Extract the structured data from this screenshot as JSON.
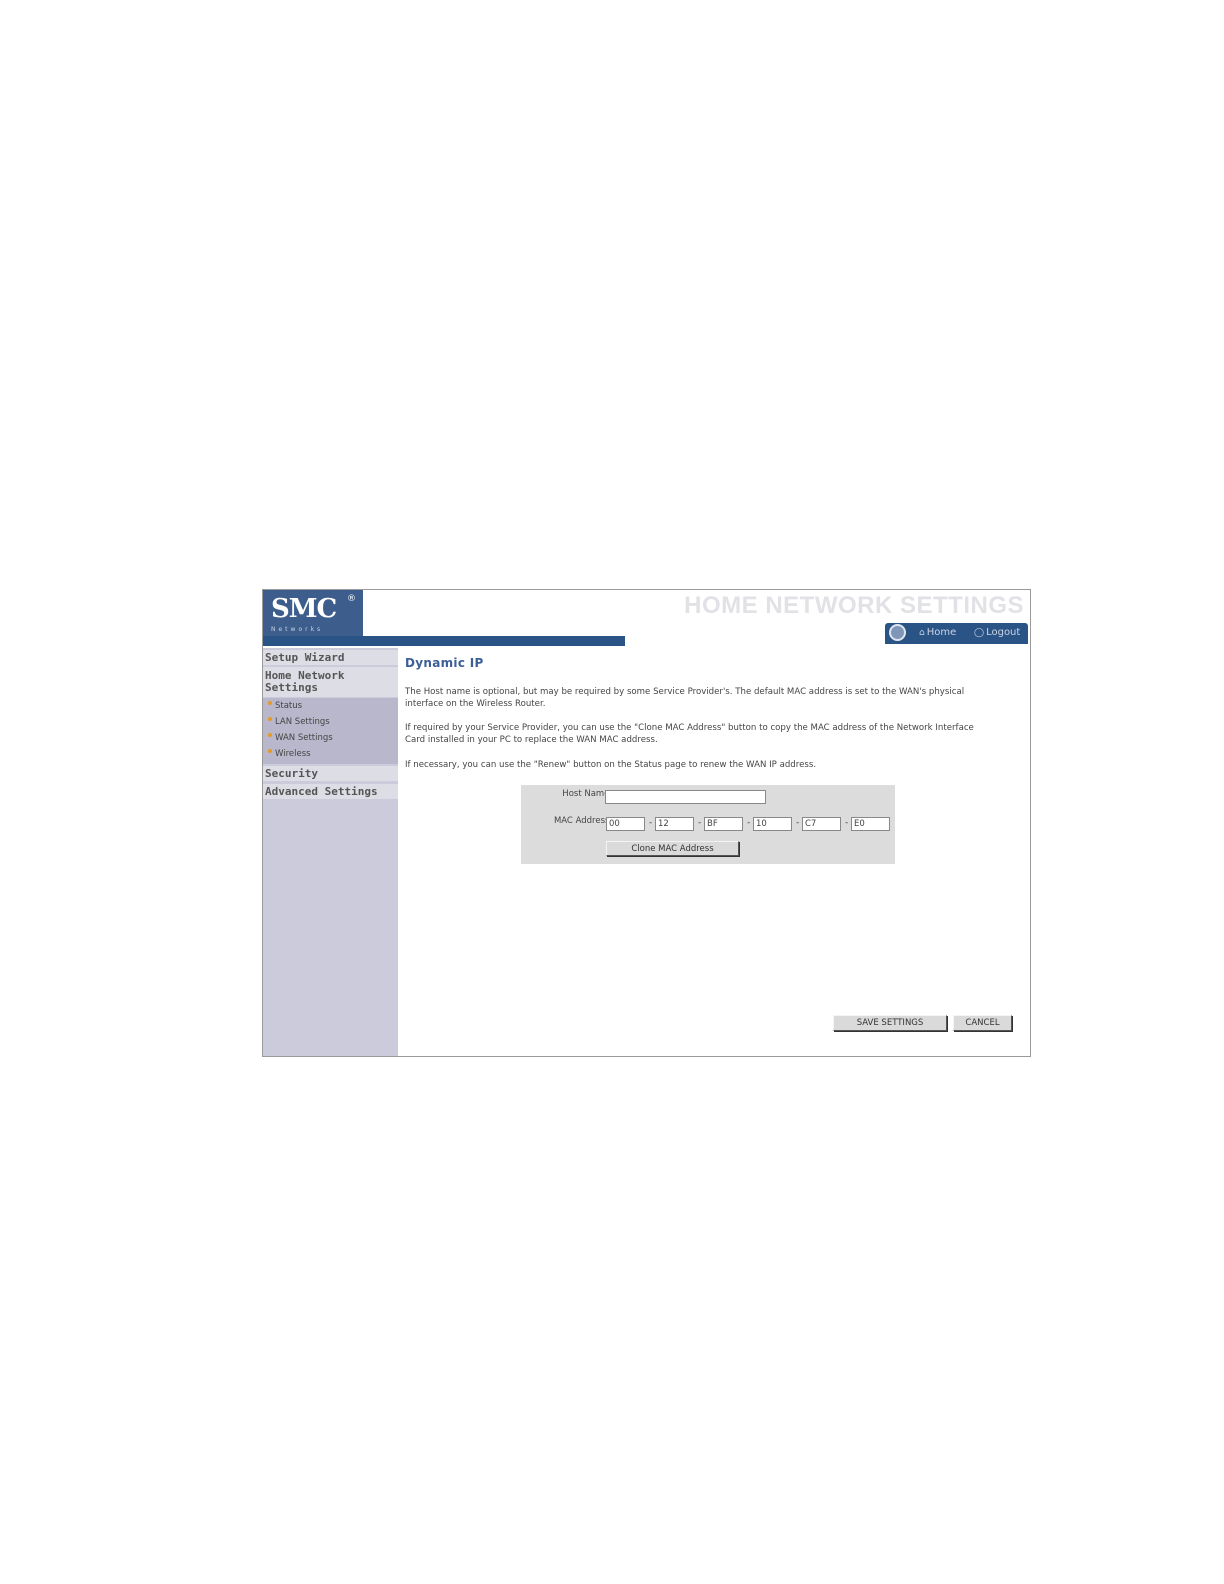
{
  "header": {
    "logo": "SMC",
    "logo_reg": "®",
    "logo_sub": "Networks",
    "page_title": "HOME NETWORK SETTINGS",
    "nav": [
      {
        "label": "Home",
        "icon": "home-icon"
      },
      {
        "label": "Logout",
        "icon": "logout-icon"
      }
    ]
  },
  "sidebar": {
    "sections": [
      {
        "label": "Setup Wizard"
      },
      {
        "label": "Home Network Settings"
      },
      {
        "label": "Security"
      },
      {
        "label": "Advanced Settings"
      }
    ],
    "sub_items": [
      {
        "label": "Status"
      },
      {
        "label": "LAN Settings"
      },
      {
        "label": "WAN Settings"
      },
      {
        "label": "Wireless"
      }
    ]
  },
  "content": {
    "title": "Dynamic IP",
    "paragraphs": [
      "The Host name is optional, but may be required by some Service Provider's. The default MAC address is set to the WAN's physical interface on the Wireless Router.",
      "If required by your Service Provider, you can use the \"Clone MAC Address\" button to copy the MAC address of the Network Interface Card installed in your PC to replace the WAN MAC address.",
      "If necessary, you can use the \"Renew\" button on the Status page to renew the WAN IP address."
    ],
    "form": {
      "host_name_label": "Host Name :",
      "host_name_value": "",
      "mac_label": "MAC Address :",
      "mac_octets": [
        "00",
        "12",
        "BF",
        "10",
        "C7",
        "E0"
      ],
      "mac_separator": "-",
      "clone_button": "Clone MAC Address"
    },
    "save_button": "SAVE SETTINGS",
    "cancel_button": "CANCEL"
  },
  "colors": {
    "brand_blue": "#2b5486",
    "title_blue": "#3d5f98",
    "sidebar_bg": "#cccbdb",
    "bullet": "#e59a24"
  }
}
